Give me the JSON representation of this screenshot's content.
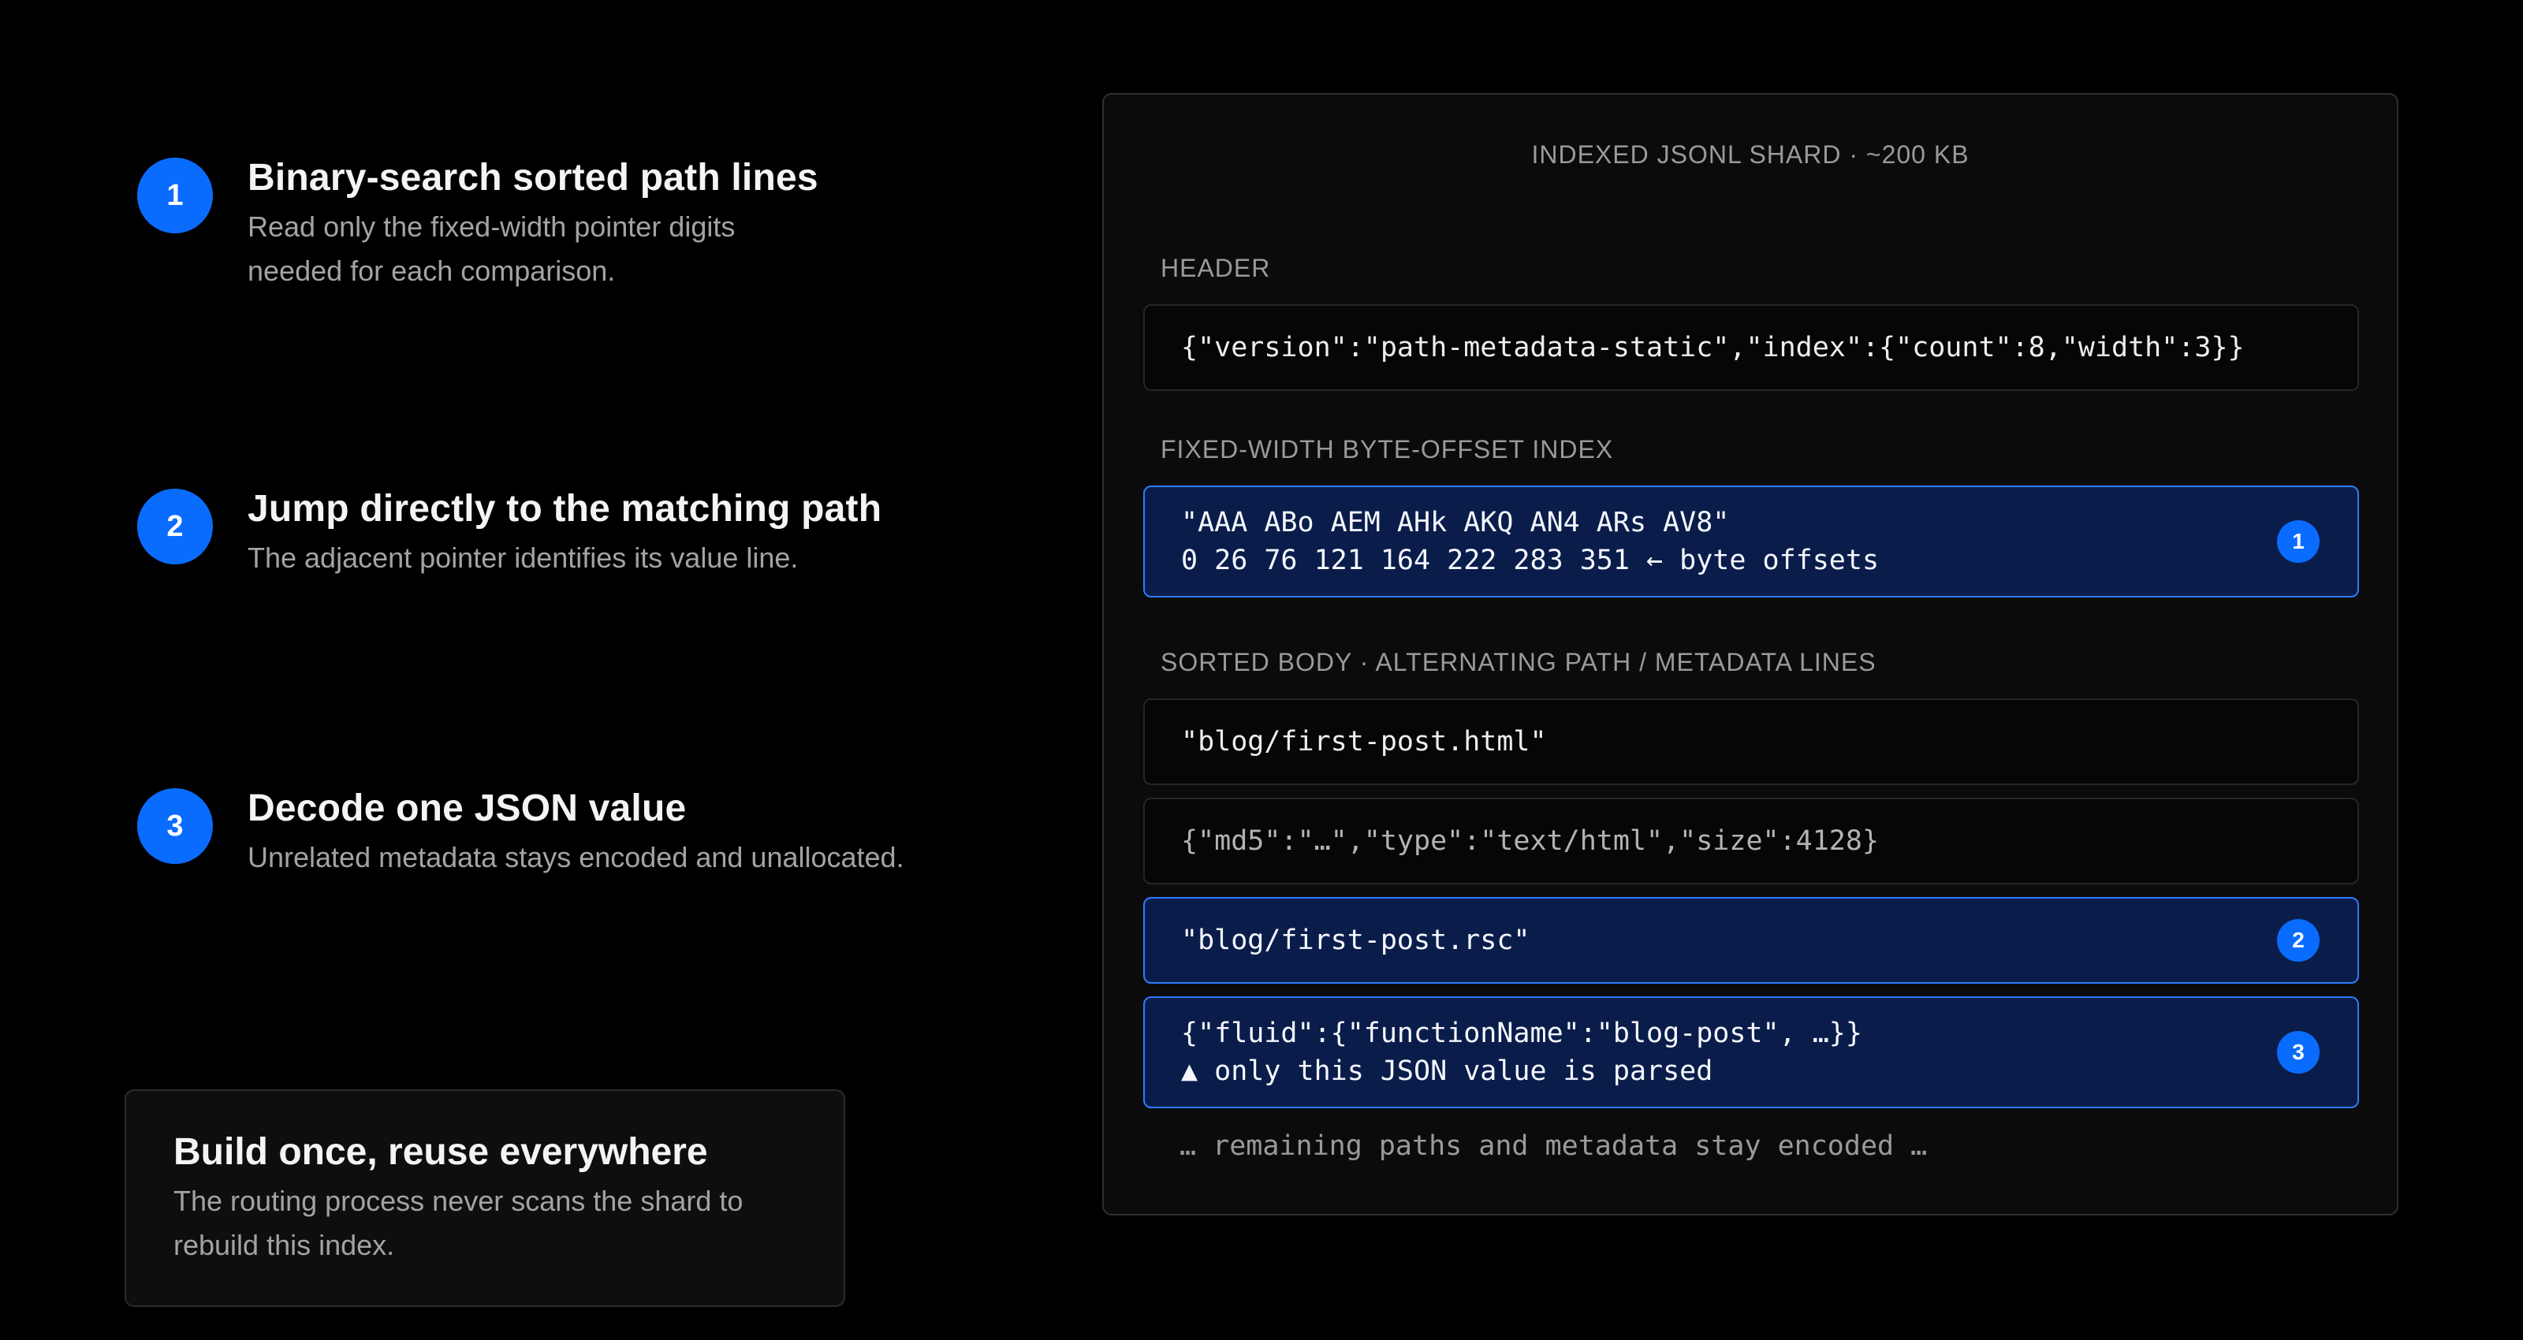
{
  "steps": [
    {
      "number": "1",
      "title": "Binary-search sorted path lines",
      "description": "Read only the fixed-width pointer digits\nneeded for each comparison."
    },
    {
      "number": "2",
      "title": "Jump directly to the matching path",
      "description": "The adjacent pointer identifies its value line."
    },
    {
      "number": "3",
      "title": "Decode one JSON value",
      "description": "Unrelated metadata stays encoded and unallocated."
    }
  ],
  "callout": {
    "title": "Build once, reuse everywhere",
    "description": "The routing process never scans the shard to\nrebuild this index."
  },
  "panel": {
    "title": "INDEXED JSONL SHARD · ~200 KB",
    "header": {
      "label": "HEADER",
      "line": "{\"version\":\"path-metadata-static\",\"index\":{\"count\":8,\"width\":3}}"
    },
    "index": {
      "label": "FIXED-WIDTH BYTE-OFFSET INDEX",
      "line1": "\"AAA ABo AEM AHk AKQ AN4 ARs AV8\"",
      "line2": "0 26 76 121 164 222 283 351 ← byte offsets",
      "badge": "1"
    },
    "body": {
      "label": "SORTED BODY · ALTERNATING PATH / METADATA LINES",
      "rows": [
        {
          "line1": "\"blog/first-post.html\""
        },
        {
          "line1": "{\"md5\":\"…\",\"type\":\"text/html\",\"size\":4128}"
        },
        {
          "line1": "\"blog/first-post.rsc\"",
          "badge": "2"
        },
        {
          "line1": "{\"fluid\":{\"functionName\":\"blog-post\", …}}",
          "line2": "▲ only this JSON value is parsed",
          "badge": "3"
        }
      ]
    },
    "footer": "… remaining paths and metadata stay encoded …"
  },
  "colors": {
    "background": "#000000",
    "accent": "#0a6cff",
    "highlight_fill": "#0a1d4a",
    "highlight_border": "#2f7cff"
  }
}
